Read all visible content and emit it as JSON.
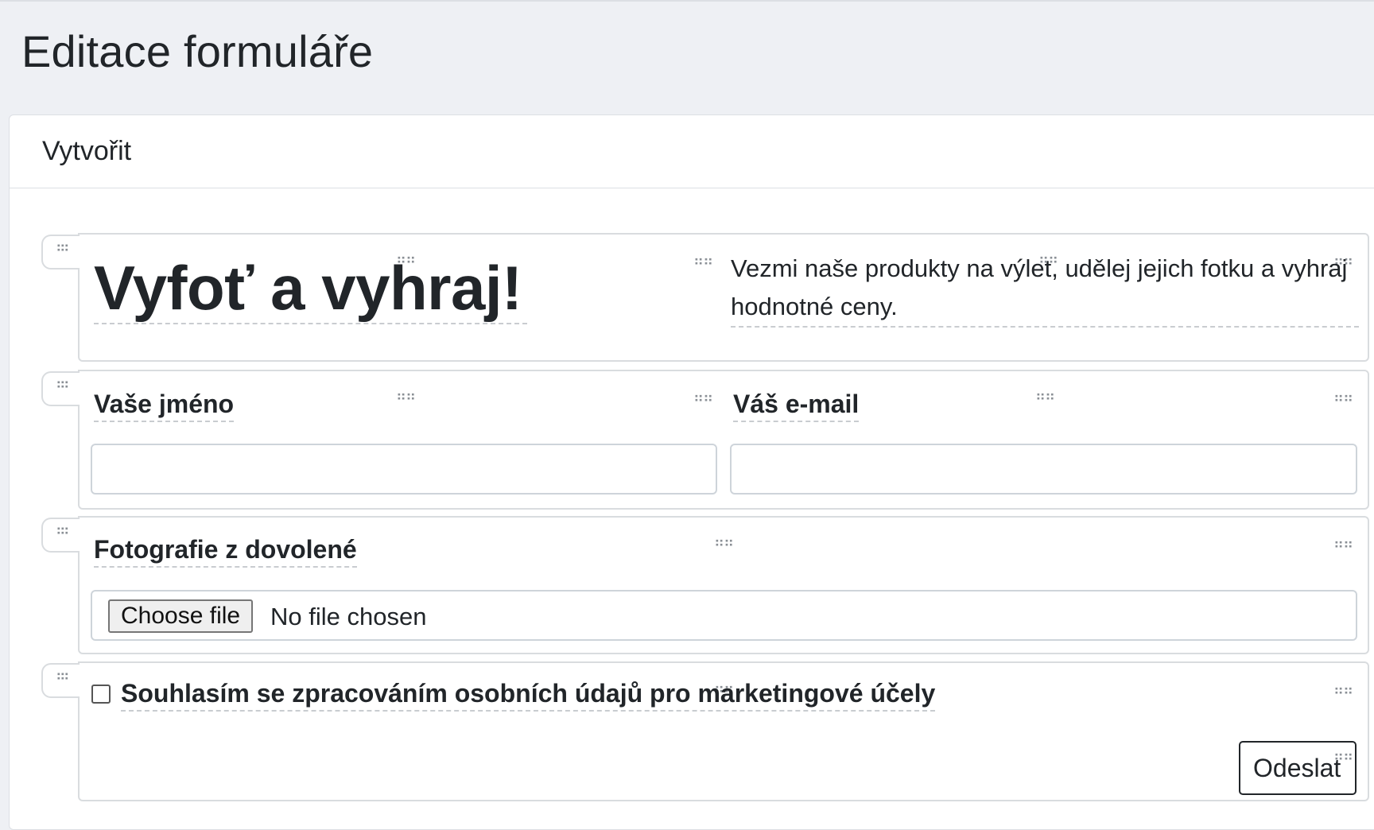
{
  "page": {
    "title": "Editace formuláře"
  },
  "card": {
    "header": "Vytvořit"
  },
  "form": {
    "hero": {
      "heading": "Vyfoť a vyhraj!",
      "description": "Vezmi naše produkty na výlet, udělej jejich fotku a vyhraj hodnotné ceny."
    },
    "name_field": {
      "label": "Vaše jméno",
      "value": "",
      "placeholder": ""
    },
    "email_field": {
      "label": "Váš e-mail",
      "value": "",
      "placeholder": ""
    },
    "photo_field": {
      "label": "Fotografie z dovolené",
      "button_label": "Choose file",
      "status": "No file chosen"
    },
    "consent": {
      "label": "Souhlasím se zpracováním osobních údajů pro marketingové účely",
      "checked": false
    },
    "submit": {
      "label": "Odeslat"
    }
  },
  "icons": {
    "row_handle": "grip-vertical-icon",
    "element_handle": "grip-horizontal-icon"
  }
}
